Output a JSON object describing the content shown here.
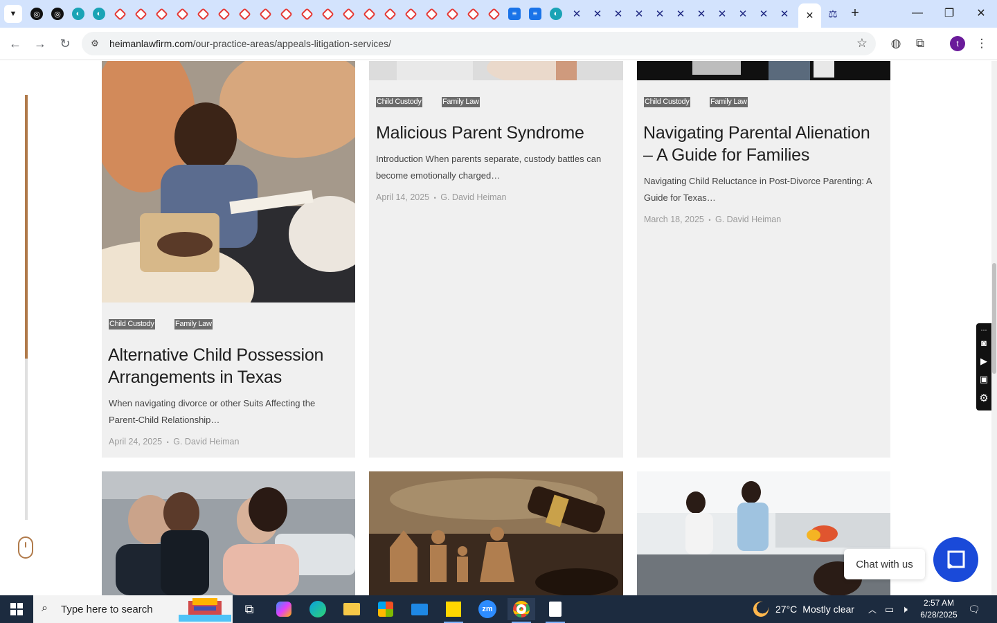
{
  "browser": {
    "url_host": "heimanlawfirm.com",
    "url_path": "/our-practice-areas/appeals-litigation-services/",
    "profile_initial": "t",
    "icons": {
      "back": "arrow-left-icon",
      "forward": "arrow-right-icon",
      "reload": "reload-icon",
      "site_info": "tune-icon",
      "bookmark": "star-icon",
      "extensions": "puzzle-icon",
      "menu": "kebab-menu-icon"
    }
  },
  "page": {
    "accent_color": "#b07a4a",
    "scroll_progress": 0.62,
    "articles": [
      {
        "tags": [
          "Child Custody",
          "Family Law"
        ],
        "title": "Alternative Child Possession Arrangements in Texas",
        "excerpt": "When navigating divorce or other Suits Affecting the Parent-Child Relationship…",
        "date": "April 24, 2025",
        "author": "G. David Heiman"
      },
      {
        "tags": [
          "Child Custody",
          "Family Law"
        ],
        "title": "Malicious Parent Syndrome",
        "excerpt": "Introduction When parents separate, custody battles can become emotionally charged…",
        "date": "April 14, 2025",
        "author": "G. David Heiman"
      },
      {
        "tags": [
          "Child Custody",
          "Family Law"
        ],
        "title": "Navigating Parental Alienation – A Guide for Families",
        "excerpt": "Navigating Child Reluctance in Post-Divorce Parenting: A Guide for Texas…",
        "date": "March 18, 2025",
        "author": "G. David Heiman"
      }
    ],
    "meta_separator": "•",
    "chat_label": "Chat with us"
  },
  "taskbar": {
    "search_placeholder": "Type here to search",
    "weather_temp": "27°C",
    "weather_desc": "Mostly clear",
    "time": "2:57 AM",
    "date": "6/28/2025"
  }
}
